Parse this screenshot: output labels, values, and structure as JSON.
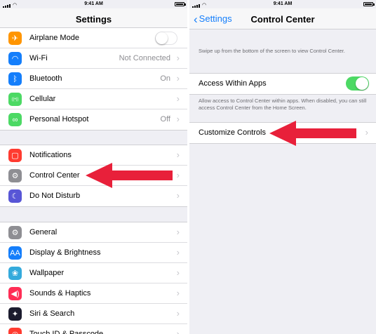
{
  "status_bar": {
    "time": "9:41 AM"
  },
  "colors": {
    "accent": "#147efb",
    "arrow": "#e8203a",
    "toggle_on": "#4cd964"
  },
  "left": {
    "title": "Settings",
    "group1": [
      {
        "label": "Airplane Mode",
        "value": "",
        "icon": "airplane-icon",
        "color": "#ff9500",
        "glyph": "✈",
        "control": "toggle-off"
      },
      {
        "label": "Wi-Fi",
        "value": "Not Connected",
        "icon": "wifi-icon",
        "color": "#147efb",
        "glyph": "◠",
        "control": "chevron"
      },
      {
        "label": "Bluetooth",
        "value": "On",
        "icon": "bluetooth-icon",
        "color": "#147efb",
        "glyph": "ᛒ",
        "control": "chevron"
      },
      {
        "label": "Cellular",
        "value": "",
        "icon": "cellular-icon",
        "color": "#4cd964",
        "glyph": "((•))",
        "control": "chevron"
      },
      {
        "label": "Personal Hotspot",
        "value": "Off",
        "icon": "hotspot-icon",
        "color": "#4cd964",
        "glyph": "∞",
        "control": "chevron"
      }
    ],
    "group2": [
      {
        "label": "Notifications",
        "value": "",
        "icon": "notifications-icon",
        "color": "#ff3b30",
        "glyph": "▢",
        "control": "chevron"
      },
      {
        "label": "Control Center",
        "value": "",
        "icon": "control-center-icon",
        "color": "#8e8e93",
        "glyph": "⚙",
        "control": "chevron"
      },
      {
        "label": "Do Not Disturb",
        "value": "",
        "icon": "moon-icon",
        "color": "#5856d6",
        "glyph": "☾",
        "control": "chevron"
      }
    ],
    "group3": [
      {
        "label": "General",
        "value": "",
        "icon": "gear-icon",
        "color": "#8e8e93",
        "glyph": "⚙",
        "control": "chevron"
      },
      {
        "label": "Display & Brightness",
        "value": "",
        "icon": "display-icon",
        "color": "#147efb",
        "glyph": "AA",
        "control": "chevron"
      },
      {
        "label": "Wallpaper",
        "value": "",
        "icon": "wallpaper-icon",
        "color": "#34aadc",
        "glyph": "❀",
        "control": "chevron"
      },
      {
        "label": "Sounds & Haptics",
        "value": "",
        "icon": "speaker-icon",
        "color": "#ff2d55",
        "glyph": "◀)",
        "control": "chevron"
      },
      {
        "label": "Siri & Search",
        "value": "",
        "icon": "siri-icon",
        "color": "#1c1c2e",
        "glyph": "✦",
        "control": "chevron"
      },
      {
        "label": "Touch ID & Passcode",
        "value": "",
        "icon": "fingerprint-icon",
        "color": "#ff3b30",
        "glyph": "◎",
        "control": "chevron"
      }
    ]
  },
  "right": {
    "back_label": "Settings",
    "title": "Control Center",
    "intro": "Swipe up from the bottom of the screen to view Control Center.",
    "access_label": "Access Within Apps",
    "access_on": true,
    "access_note": "Allow access to Control Center within apps. When disabled, you can still access Control Center from the Home Screen.",
    "customize_label": "Customize Controls"
  }
}
